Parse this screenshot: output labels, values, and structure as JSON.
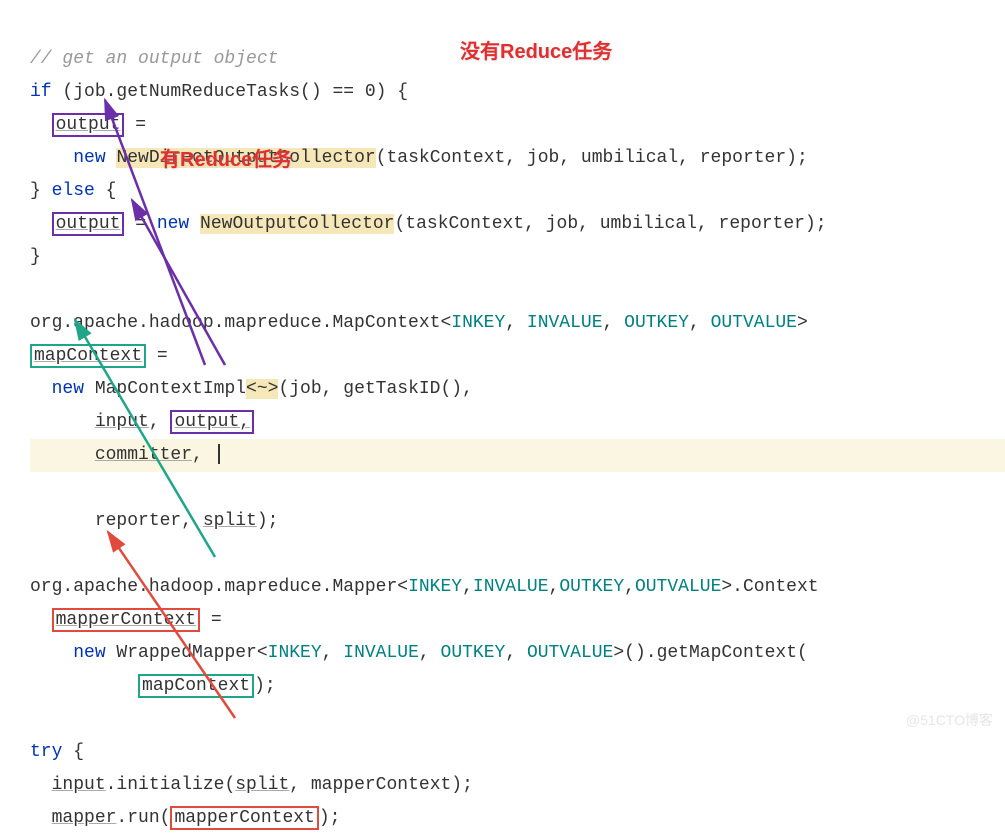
{
  "lineHeight": 33,
  "annotations": {
    "no_reduce": "没有Reduce任务",
    "has_reduce": "有Reduce任务"
  },
  "watermark": "@51CTO博客",
  "code": {
    "l1_comment": "// get an output object",
    "l2": {
      "if": "if",
      "cond": " (job.getNumReduceTasks() == 0) {"
    },
    "l3": {
      "output": "output",
      "eq": " ="
    },
    "l4": {
      "new": "new",
      "sp": " ",
      "cls": "NewDirectOutputCollector",
      "args": "(taskContext, job, umbilical, reporter);"
    },
    "l5": {
      "else": "} else {"
    },
    "l6": {
      "output": "output",
      "eq": " = ",
      "new": "new",
      "sp": " ",
      "cls": "NewOutputCollector",
      "args": "(taskContext, job, umbilical, reporter);"
    },
    "l7": "}",
    "l9": {
      "pkg": "org.apache.hadoop.mapreduce.MapContext<",
      "g1": "INKEY",
      "c": ", ",
      "g2": "INVALUE",
      "g3": "OUTKEY",
      "g4": "OUTVALUE",
      "end": ">"
    },
    "l10": {
      "mapContext": "mapContext",
      "eq": " ="
    },
    "l11": {
      "new": "new",
      "cls": " MapContextImpl",
      "gen": "<~>",
      "args": "(job, getTaskID(),"
    },
    "l12": {
      "input": "input",
      "c": ", ",
      "output": "output,"
    },
    "l13": {
      "committer": "committer",
      "c": ", "
    },
    "l14": {
      "rep": "reporter, ",
      "split": "split",
      "end": ");"
    },
    "l16": {
      "pkg": "org.apache.hadoop.mapreduce.Mapper<",
      "g1": "INKEY",
      "c": ",",
      "g2": "INVALUE",
      "g3": "OUTKEY",
      "g4": "OUTVALUE",
      "end": ">.Context"
    },
    "l17": {
      "mapperContext": "mapperContext",
      "eq": " ="
    },
    "l18": {
      "new": "new",
      "cls": " WrappedMapper<",
      "g1": "INKEY",
      "c": ", ",
      "g2": "INVALUE",
      "g3": "OUTKEY",
      "g4": "OUTVALUE",
      "end": ">().getMapContext("
    },
    "l19": {
      "mapContext": "mapContext",
      "end": ");"
    },
    "l21": {
      "try": "try",
      "brace": " {"
    },
    "l22": {
      "input": "input",
      "init": ".initialize(",
      "split": "split",
      "rest": ", mapperContext);"
    },
    "l23": {
      "mapper": "mapper",
      "run": ".run(",
      "mapperContext": "mapperContext",
      "end": ");"
    }
  }
}
